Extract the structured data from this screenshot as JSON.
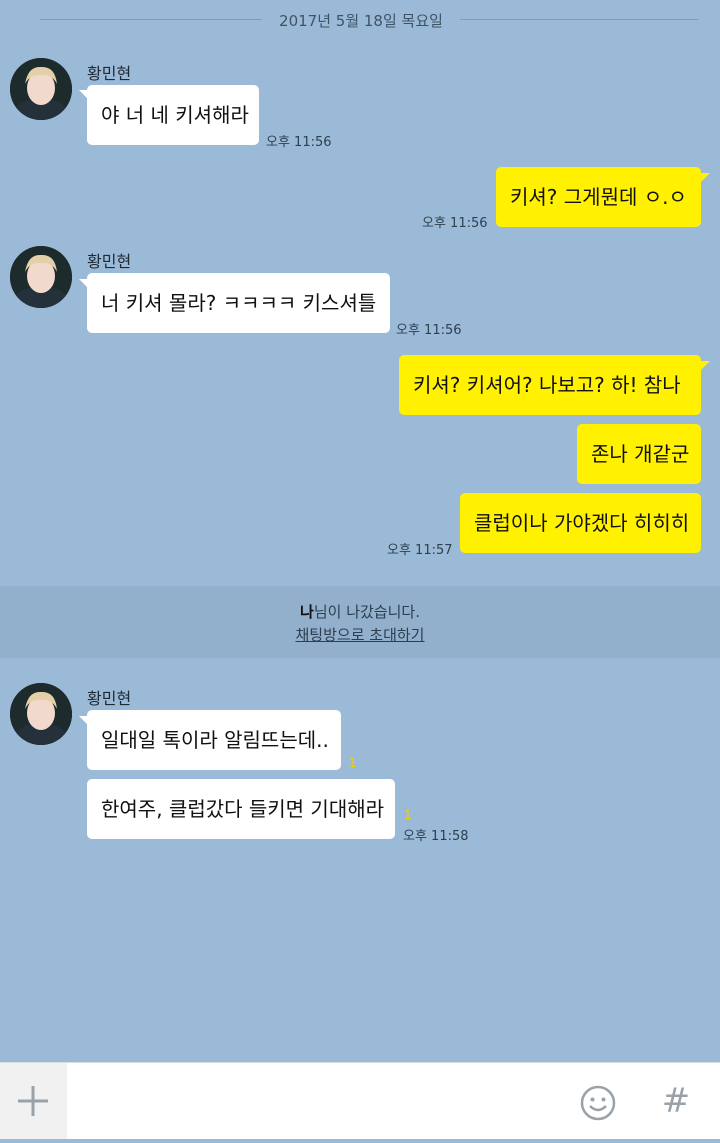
{
  "date_separator": "2017년 5월 18일 목요일",
  "contact_name": "황민현",
  "groups": [
    {
      "name": "황민현",
      "messages": [
        "야 너 네 키셔해라"
      ],
      "time": "오후 11:56"
    },
    {
      "messages": [
        "키셔? 그게뭔데 ㅇ.ㅇ"
      ],
      "time": "오후 11:56"
    },
    {
      "name": "황민현",
      "messages": [
        "너 키셔 몰라? ㅋㅋㅋㅋ 키스셔틀"
      ],
      "time": "오후 11:56"
    },
    {
      "messages": [
        "키셔? 키셔어? 나보고? 하! 참나",
        "존나 개같군",
        "클럽이나 가야겠다 히히히"
      ],
      "time": "오후 11:57"
    },
    {
      "name": "황민현",
      "messages": [
        "일대일 톡이라 알림뜨는데..",
        "한여주, 클럽갔다 들키면 기대해라"
      ],
      "unread": [
        "1",
        "1"
      ],
      "time": "오후 11:58"
    }
  ],
  "notice": {
    "name": "나",
    "left_text": "님이 나갔습니다.",
    "invite_link": "채팅방으로 초대하기"
  },
  "input_bar": {
    "plus_icon": "plus-icon",
    "emoji_icon": "emoji-icon",
    "hash_icon": "hashtag-icon",
    "hash_glyph": "#",
    "placeholder": ""
  },
  "colors": {
    "background": "#9bbad8",
    "incoming_bubble": "#ffffff",
    "outgoing_bubble": "#fff100",
    "unread": "#f1d000"
  }
}
